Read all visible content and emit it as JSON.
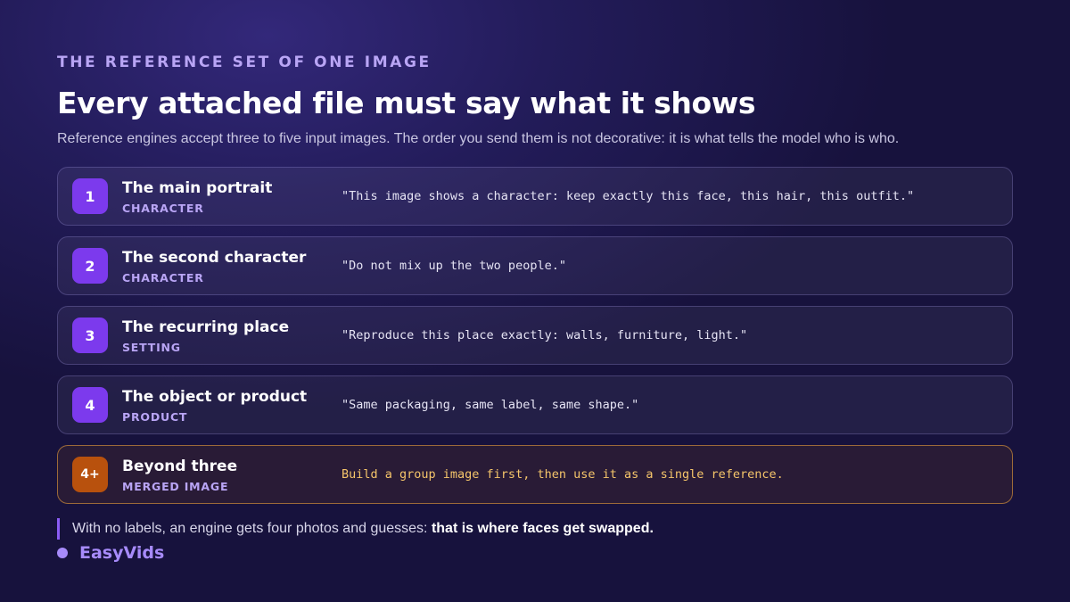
{
  "header": {
    "eyebrow": "THE REFERENCE SET OF ONE IMAGE",
    "title": "Every attached file must say what it shows",
    "subtitle": "Reference engines accept three to five input images. The order you send them is not decorative: it is what tells the model who is who."
  },
  "cards": [
    {
      "number": "1",
      "title": "The main portrait",
      "tag": "CHARACTER",
      "quote": "\"This image shows a character: keep exactly this face, this hair, this outfit.\""
    },
    {
      "number": "2",
      "title": "The second character",
      "tag": "CHARACTER",
      "quote": "\"Do not mix up the two people.\""
    },
    {
      "number": "3",
      "title": "The recurring place",
      "tag": "SETTING",
      "quote": "\"Reproduce this place exactly: walls, furniture, light.\""
    },
    {
      "number": "4",
      "title": "The object or product",
      "tag": "PRODUCT",
      "quote": "\"Same packaging, same label, same shape.\""
    },
    {
      "number": "4+",
      "title": "Beyond three",
      "tag": "MERGED IMAGE",
      "quote": "Build a group image first, then use it as a single reference."
    }
  ],
  "footer": {
    "note": "With no labels, an engine gets four photos and guesses: ",
    "note_emphasis": "that is where faces get swapped."
  },
  "brand": {
    "name": "EasyVids"
  },
  "colors": {
    "accent": "#7c3aed",
    "accent_light": "#b9a5f5",
    "highlight": "#b8510d",
    "highlight_text": "#f5c56a",
    "background": "#1e1850"
  }
}
